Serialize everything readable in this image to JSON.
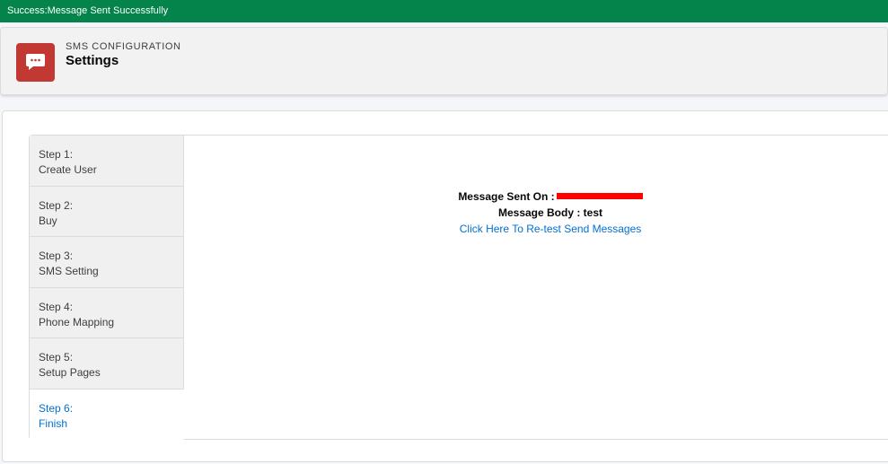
{
  "toast": {
    "message": "Success:Message Sent Successfully",
    "color": "#04844b"
  },
  "header": {
    "icon": "chat-bubble-icon",
    "icon_color": "#c23934",
    "eyebrow": "SMS CONFIGURATION",
    "title": "Settings"
  },
  "steps": [
    {
      "number": "Step 1:",
      "label": "Create User",
      "active": false
    },
    {
      "number": "Step 2:",
      "label": "Buy",
      "active": false
    },
    {
      "number": "Step 3:",
      "label": "SMS Setting",
      "active": false
    },
    {
      "number": "Step 4:",
      "label": "Phone Mapping",
      "active": false
    },
    {
      "number": "Step 5:",
      "label": "Setup Pages",
      "active": false
    },
    {
      "number": "Step 6:",
      "label": "Finish",
      "active": true
    }
  ],
  "result": {
    "sent_on_label": "Message Sent On :",
    "body_label": "Message Body :",
    "body_value": "test",
    "retest_link": "Click Here To Re-test Send Messages"
  },
  "colors": {
    "link": "#0070d2",
    "redaction": "#ff0000"
  }
}
